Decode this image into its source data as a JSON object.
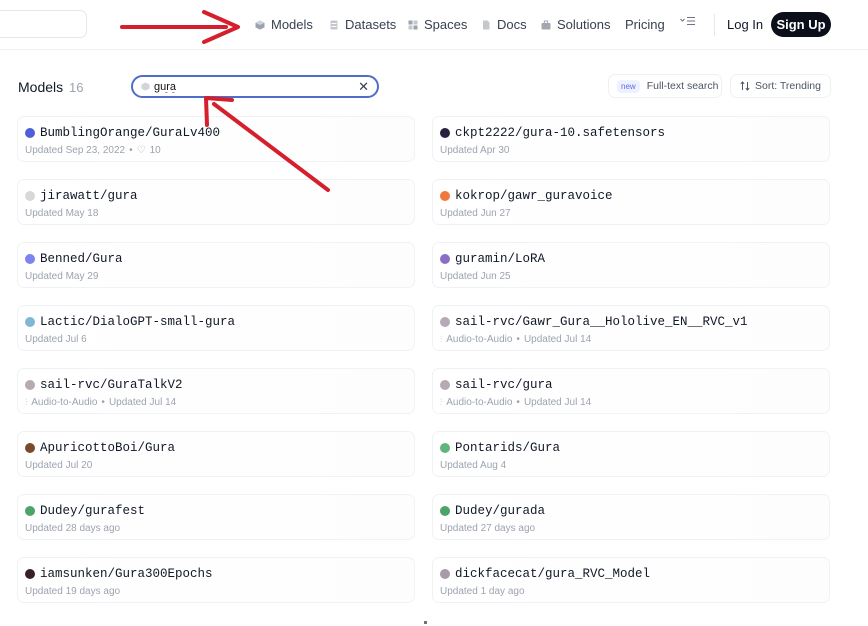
{
  "nav": {
    "items": [
      {
        "label": "Models",
        "icon": "cube-icon"
      },
      {
        "label": "Datasets",
        "icon": "database-icon"
      },
      {
        "label": "Spaces",
        "icon": "grid-icon"
      },
      {
        "label": "Docs",
        "icon": "docs-icon"
      },
      {
        "label": "Solutions",
        "icon": "briefcase-icon"
      },
      {
        "label": "Pricing",
        "icon": ""
      }
    ],
    "more_icon": "menu-icon",
    "login": "Log In",
    "signup": "Sign Up"
  },
  "subheader": {
    "title": "Models",
    "count": "16",
    "filter_value": "gura",
    "clear_icon": "close-icon",
    "fts_badge": "new",
    "fts_label": "Full-text search",
    "sort_label": "Sort:  Trending"
  },
  "models": [
    {
      "name": "BumblingOrange/GuraLv400",
      "task": "",
      "updated": "Updated Sep 23, 2022",
      "likes": "10",
      "avatar": "#4f5fd9"
    },
    {
      "name": "ckpt2222/gura-10.safetensors",
      "task": "",
      "updated": "Updated Apr 30",
      "likes": "",
      "avatar": "#2a2140"
    },
    {
      "name": "jirawatt/gura",
      "task": "",
      "updated": "Updated May 18",
      "likes": "",
      "avatar": "#d8d8d8"
    },
    {
      "name": "kokrop/gawr_guravoice",
      "task": "",
      "updated": "Updated Jun 27",
      "likes": "",
      "avatar": "#f0783c"
    },
    {
      "name": "Benned/Gura",
      "task": "",
      "updated": "Updated May 29",
      "likes": "",
      "avatar": "#7c83f2"
    },
    {
      "name": "guramin/LoRA",
      "task": "",
      "updated": "Updated Jun 25",
      "likes": "",
      "avatar": "#8b6fc4"
    },
    {
      "name": "Lactic/DialoGPT-small-gura",
      "task": "",
      "updated": "Updated Jul 6",
      "likes": "",
      "avatar": "#7fb7d6"
    },
    {
      "name": "sail-rvc/Gawr_Gura__Hololive_EN__RVC_v1",
      "task": "Audio-to-Audio",
      "updated": "Updated Jul 14",
      "likes": "",
      "avatar": "#b8aab4"
    },
    {
      "name": "sail-rvc/GuraTalkV2",
      "task": "Audio-to-Audio",
      "updated": "Updated Jul 14",
      "likes": "",
      "avatar": "#b8aab4"
    },
    {
      "name": "sail-rvc/gura",
      "task": "Audio-to-Audio",
      "updated": "Updated Jul 14",
      "likes": "",
      "avatar": "#b8aab4"
    },
    {
      "name": "ApuricottoBoi/Gura",
      "task": "",
      "updated": "Updated Jul 20",
      "likes": "",
      "avatar": "#7a4a2c"
    },
    {
      "name": "Pontarids/Gura",
      "task": "",
      "updated": "Updated Aug 4",
      "likes": "",
      "avatar": "#5fb67d"
    },
    {
      "name": "Dudey/gurafest",
      "task": "",
      "updated": "Updated 28 days ago",
      "likes": "",
      "avatar": "#4ea36b"
    },
    {
      "name": "Dudey/gurada",
      "task": "",
      "updated": "Updated 27 days ago",
      "likes": "",
      "avatar": "#4ea36b"
    },
    {
      "name": "iamsunken/Gura300Epochs",
      "task": "",
      "updated": "Updated 19 days ago",
      "likes": "",
      "avatar": "#3a1f2a"
    },
    {
      "name": "dickfacecat/gura_RVC_Model",
      "task": "",
      "updated": "Updated 1 day ago",
      "likes": "",
      "avatar": "#a99aaa"
    }
  ],
  "colors": {
    "arrow": "#d61f2c",
    "signup_bg": "#0b0f19",
    "focus_ring": "#4f6ec7"
  }
}
